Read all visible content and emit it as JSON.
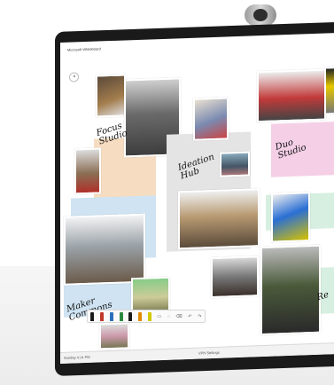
{
  "app": {
    "title": "Microsoft Whiteboard"
  },
  "board": {
    "labels": [
      {
        "text": "Focus\nStudio"
      },
      {
        "text": "Ideation\nHub"
      },
      {
        "text": "Duo\nStudio"
      },
      {
        "text": "Maker\nCommons"
      },
      {
        "text": "Re"
      }
    ]
  },
  "toolbar": {
    "pen_colors": [
      "#1a1a1a",
      "#c0392b",
      "#2c6fbb",
      "#2a8a3e",
      "#1a1a1a",
      "#e08a00",
      "#d4c800"
    ],
    "tools": [
      "ruler-icon",
      "lasso-icon",
      "eraser-icon",
      "undo-icon",
      "redo-icon"
    ]
  },
  "statusbar": {
    "left": "Sunday 4:14 PM",
    "right": "VPN    Settings"
  }
}
